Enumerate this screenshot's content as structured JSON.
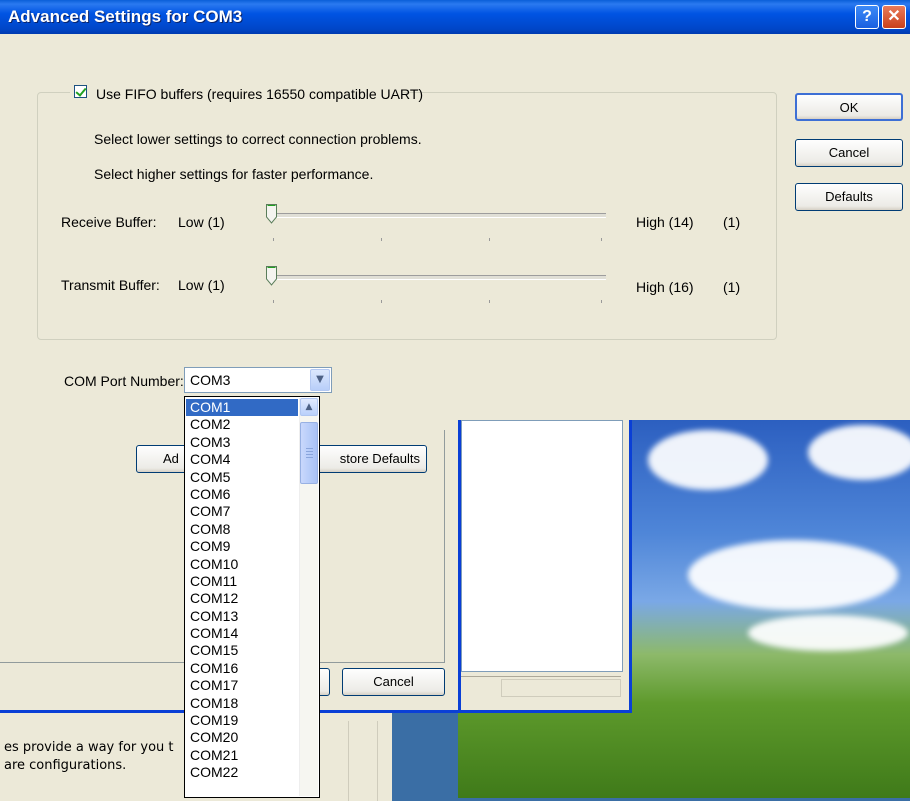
{
  "dialog": {
    "title": "Advanced Settings for COM3",
    "fifo_label": "Use FIFO buffers (requires 16550 compatible UART)",
    "fifo_checked": true,
    "hint_lower": "Select lower settings to correct connection problems.",
    "hint_higher": "Select higher settings for faster performance.",
    "receive": {
      "label": "Receive Buffer:",
      "low": "Low (1)",
      "high": "High (14)",
      "value": "(1)",
      "level": 0
    },
    "transmit": {
      "label": "Transmit Buffer:",
      "low": "Low (1)",
      "high": "High (16)",
      "value": "(1)",
      "level": 0
    },
    "ok": "OK",
    "cancel": "Cancel",
    "defaults": "Defaults",
    "com_port_label": "COM Port Number:",
    "com_port_value": "COM3",
    "com_options": [
      "COM1",
      "COM2",
      "COM3",
      "COM4",
      "COM5",
      "COM6",
      "COM7",
      "COM8",
      "COM9",
      "COM10",
      "COM11",
      "COM12",
      "COM13",
      "COM14",
      "COM15",
      "COM16",
      "COM17",
      "COM18",
      "COM19",
      "COM20",
      "COM21",
      "COM22"
    ],
    "highlighted_option": "COM1"
  },
  "background": {
    "advanced_button": "Ad",
    "restore_defaults_button": "store Defaults",
    "cancel_button": "Cancel",
    "text_line1": "es provide a way for you t",
    "text_line2": "are configurations."
  },
  "colors": {
    "titlebar": "#0054e3",
    "selection": "#316ac5",
    "dialog_bg": "#ece9d8"
  }
}
